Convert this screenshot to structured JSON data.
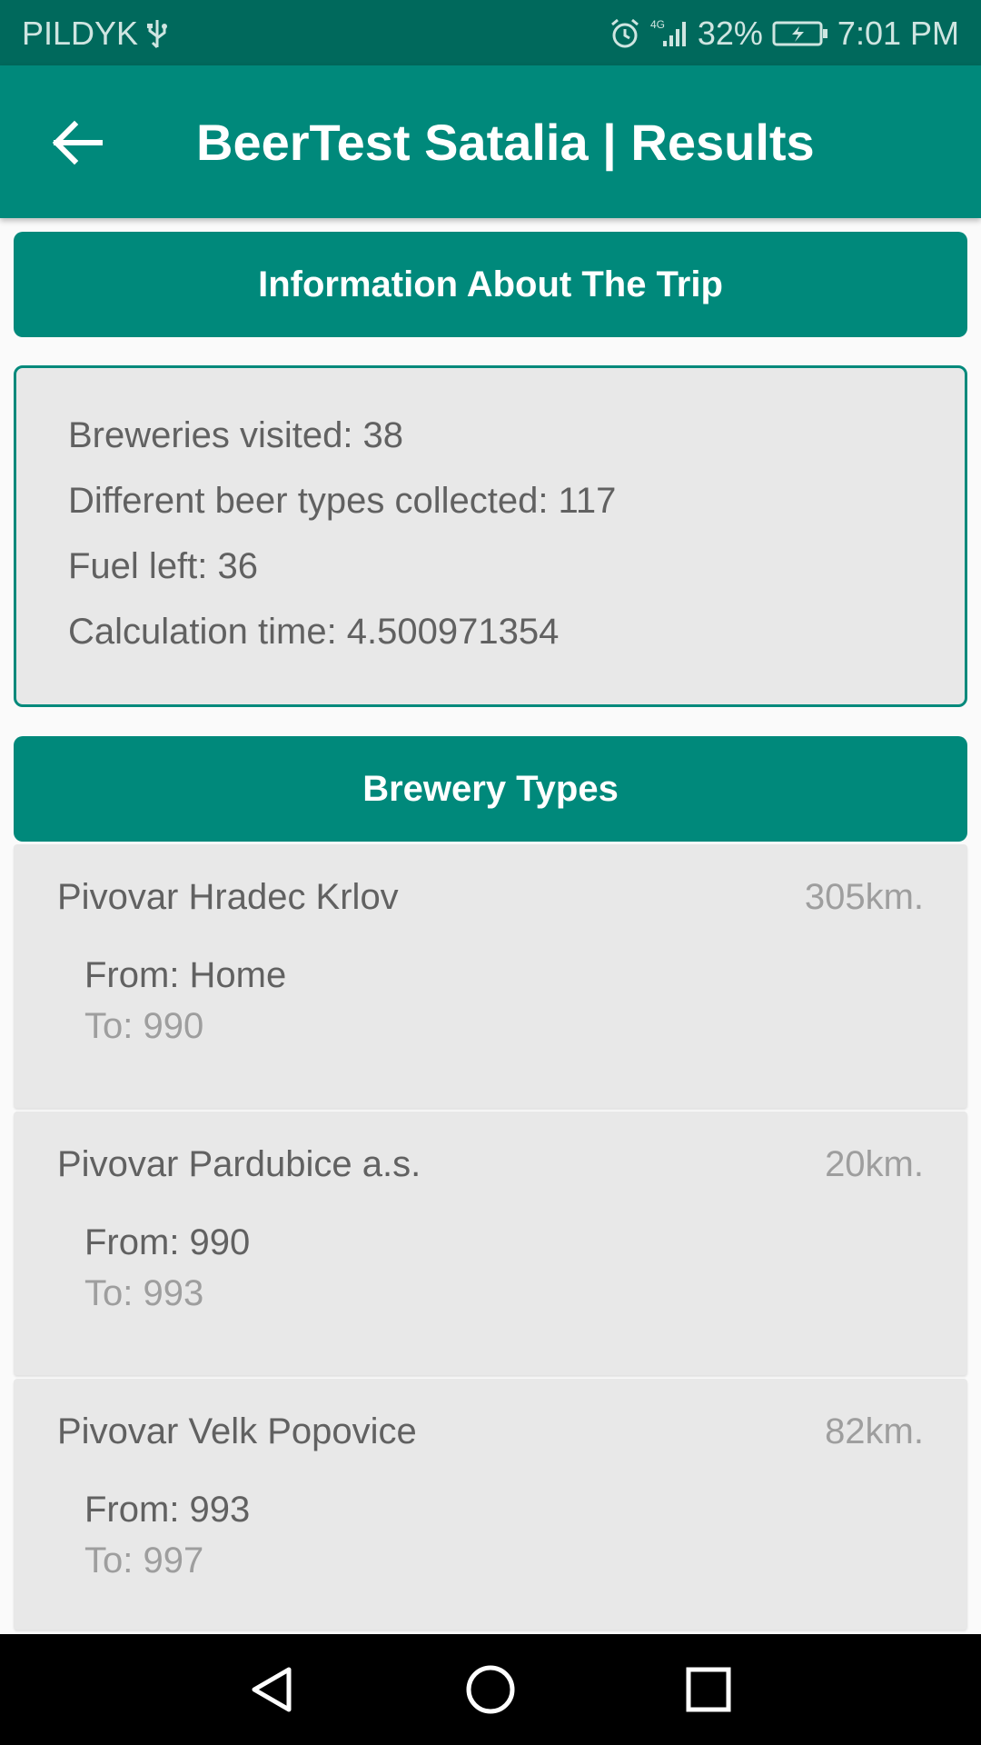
{
  "status_bar": {
    "carrier": "PILDYK",
    "battery": "32%",
    "time": "7:01 PM",
    "icons": [
      "usb-icon",
      "alarm-icon",
      "network-4g-icon",
      "signal-icon",
      "battery-charging-icon"
    ]
  },
  "app_bar": {
    "title": "BeerTest Satalia | Results",
    "back_icon": "arrow-back-icon",
    "color": "#00897b"
  },
  "trip_info": {
    "header": "Information About The Trip",
    "lines": [
      "Breweries visited: 38",
      "Different beer types collected: 117",
      "Fuel left: 36",
      "Calculation time: 4.500971354"
    ]
  },
  "breweries": {
    "header": "Brewery Types",
    "items": [
      {
        "name": "Pivovar Hradec Krlov",
        "distance": "305km.",
        "from": "From: Home",
        "to": "To: 990"
      },
      {
        "name": "Pivovar Pardubice a.s.",
        "distance": "20km.",
        "from": "From: 990",
        "to": "To: 993"
      },
      {
        "name": "Pivovar Velk Popovice",
        "distance": "82km.",
        "from": "From: 993",
        "to": "To: 997"
      }
    ]
  },
  "nav_bar": {
    "icons": [
      "back-triangle-icon",
      "home-circle-icon",
      "recents-square-icon"
    ]
  },
  "colors": {
    "status_bar": "#00695c",
    "primary": "#00897b",
    "card_bg": "#e8e8e8"
  }
}
